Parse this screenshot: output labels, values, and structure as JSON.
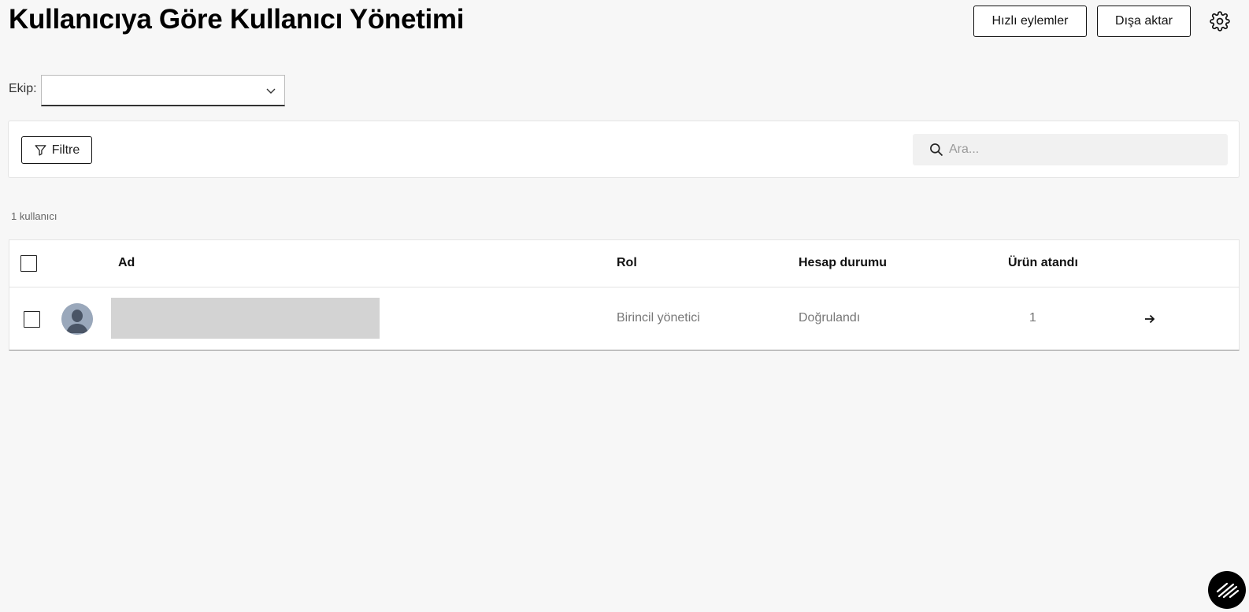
{
  "header": {
    "title": "Kullanıcıya Göre Kullanıcı Yönetimi",
    "quick_actions_label": "Hızlı eylemler",
    "export_label": "Dışa aktar",
    "settings_icon": "gear-icon"
  },
  "filters": {
    "team_label": "Ekip:",
    "team_value": "",
    "filter_button_label": "Filtre",
    "search_placeholder": "Ara...",
    "search_value": ""
  },
  "summary": {
    "user_count_text": "1 kullanıcı"
  },
  "table": {
    "columns": {
      "name": "Ad",
      "role": "Rol",
      "account_status": "Hesap durumu",
      "products_assigned": "Ürün atandı"
    },
    "rows": [
      {
        "role": "Birincil yönetici",
        "account_status": "Doğrulandı",
        "products_assigned": "1"
      }
    ]
  },
  "colors": {
    "background": "#f7f7f7",
    "surface": "#ffffff",
    "border": "#e4e4e4",
    "text_primary": "#111111",
    "text_secondary": "#777777",
    "redaction": "#d3d3d3"
  }
}
